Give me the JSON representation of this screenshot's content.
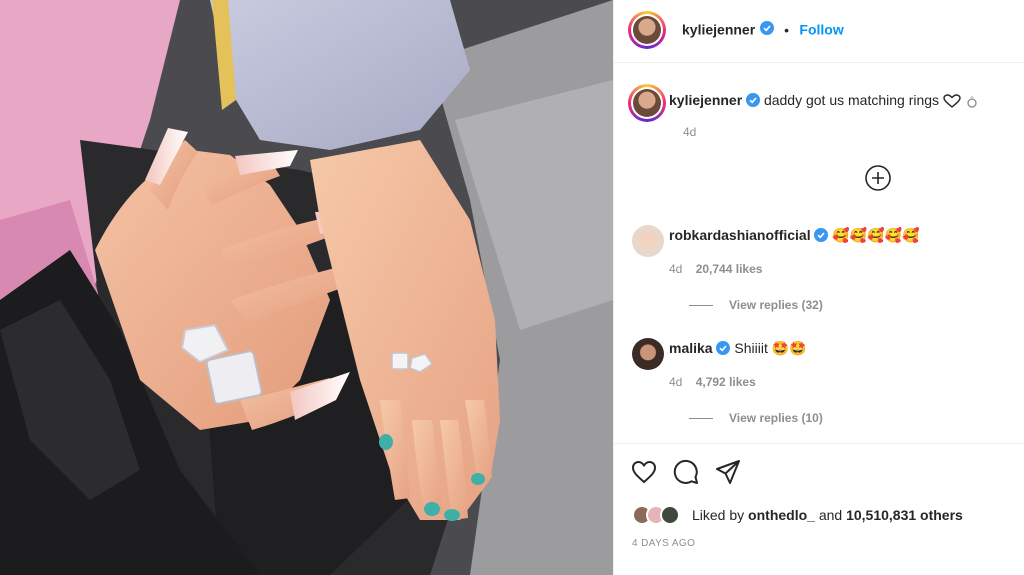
{
  "post": {
    "username": "kyliejenner",
    "follow_label": "Follow",
    "separator": "•",
    "caption": "daddy got us matching rings",
    "caption_time": "4d",
    "date": "4 DAYS AGO"
  },
  "comments": [
    {
      "username": "robkardashianofficial",
      "text": "🥰🥰🥰🥰🥰",
      "time": "4d",
      "likes": "20,744 likes",
      "replies": "View replies (32)"
    },
    {
      "username": "malika",
      "text": "Shiiiit 🤩🤩",
      "time": "4d",
      "likes": "4,792 likes",
      "replies": "View replies (10)"
    }
  ],
  "liked_by": {
    "prefix": "Liked by",
    "user": "onthedlo_",
    "middle": "and",
    "others": "10,510,831 others"
  },
  "icons": [
    "verified-badge-icon",
    "heart-outline-icon",
    "comment-icon",
    "share-icon",
    "load-more-plus-icon"
  ],
  "colors": {
    "accent": "#0095f6",
    "verified": "#3897f0",
    "muted": "#8e8e8e",
    "text": "#262626"
  }
}
